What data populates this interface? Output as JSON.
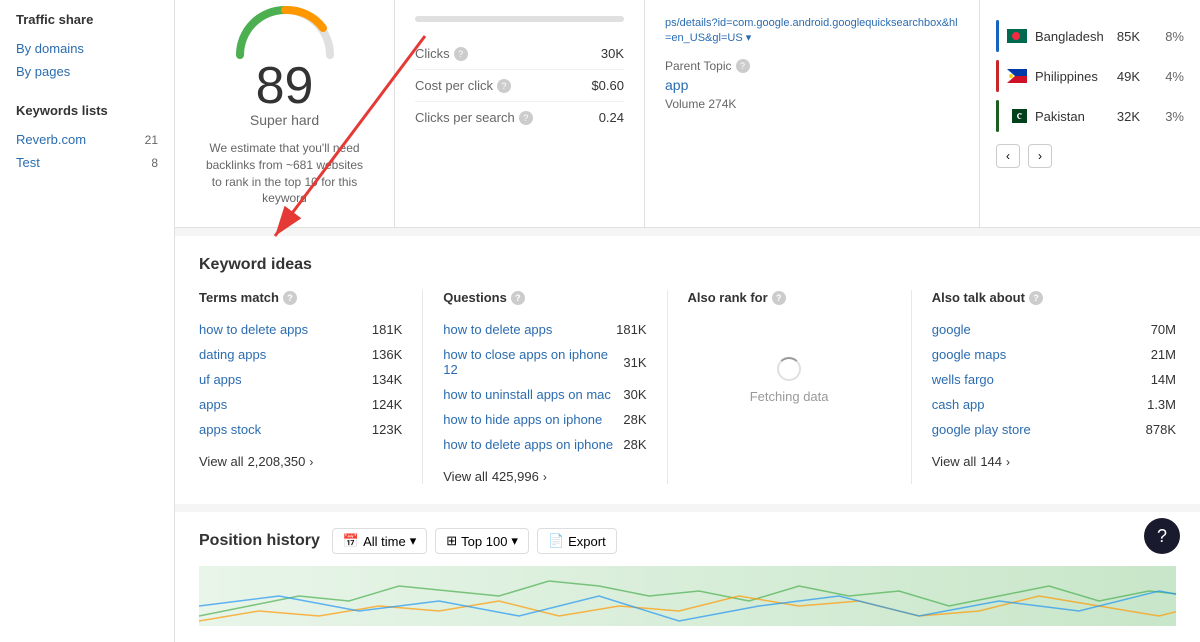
{
  "sidebar": {
    "traffic_share": {
      "title": "Traffic share",
      "items": [
        {
          "label": "By domains",
          "href": true
        },
        {
          "label": "By pages",
          "href": true
        }
      ]
    },
    "keywords_lists": {
      "title": "Keywords lists",
      "items": [
        {
          "label": "Reverb.com",
          "count": "21"
        },
        {
          "label": "Test",
          "count": "8"
        }
      ]
    }
  },
  "difficulty": {
    "score": "89",
    "label": "Super hard",
    "description": "We estimate that you'll need backlinks from ~681 websites to rank in the top 10 for this keyword"
  },
  "metrics": {
    "clicks_label": "Clicks",
    "clicks_value": "30K",
    "cpc_label": "Cost per click",
    "cpc_value": "$0.60",
    "cps_label": "Clicks per search",
    "cps_value": "0.24",
    "bar_green": 70,
    "bar_orange": 20
  },
  "url_panel": {
    "url": "ps/details?id=com.google.android.googlequicksearchbox&hl=en_US&gl=US",
    "dropdown_arrow": "▾",
    "parent_topic_label": "Parent Topic",
    "parent_topic_value": "app",
    "volume_label": "Volume 274K"
  },
  "countries": {
    "rows": [
      {
        "name": "Bangladesh",
        "volume": "85K",
        "pct": "8%",
        "color": "#1565c0"
      },
      {
        "name": "Philippines",
        "volume": "49K",
        "pct": "4%",
        "color": "#c62828"
      },
      {
        "name": "Pakistan",
        "volume": "32K",
        "pct": "3%",
        "color": "#1b5e20"
      }
    ],
    "prev_label": "‹",
    "next_label": "›"
  },
  "keyword_ideas": {
    "section_title": "Keyword ideas",
    "terms_match": {
      "header": "Terms match",
      "items": [
        {
          "keyword": "how to delete apps",
          "volume": "181K"
        },
        {
          "keyword": "dating apps",
          "volume": "136K"
        },
        {
          "keyword": "uf apps",
          "volume": "134K"
        },
        {
          "keyword": "apps",
          "volume": "124K"
        },
        {
          "keyword": "apps stock",
          "volume": "123K"
        }
      ],
      "view_all_prefix": "View all",
      "view_all_count": "2,208,350"
    },
    "questions": {
      "header": "Questions",
      "items": [
        {
          "keyword": "how to delete apps",
          "volume": "181K"
        },
        {
          "keyword": "how to close apps on iphone 12",
          "volume": "31K"
        },
        {
          "keyword": "how to uninstall apps on mac",
          "volume": "30K"
        },
        {
          "keyword": "how to hide apps on iphone",
          "volume": "28K"
        },
        {
          "keyword": "how to delete apps on iphone",
          "volume": "28K"
        }
      ],
      "view_all_prefix": "View all",
      "view_all_count": "425,996"
    },
    "also_rank_for": {
      "header": "Also rank for",
      "fetching": "Fetching data"
    },
    "also_talk_about": {
      "header": "Also talk about",
      "items": [
        {
          "keyword": "google",
          "volume": "70M"
        },
        {
          "keyword": "google maps",
          "volume": "21M"
        },
        {
          "keyword": "wells fargo",
          "volume": "14M"
        },
        {
          "keyword": "cash app",
          "volume": "1.3M"
        },
        {
          "keyword": "google play store",
          "volume": "878K"
        }
      ],
      "view_all_prefix": "View all",
      "view_all_count": "144"
    }
  },
  "position_history": {
    "title": "Position history",
    "controls": [
      {
        "icon": "📅",
        "label": "All time",
        "has_arrow": true
      },
      {
        "icon": "⊞",
        "label": "Top 100",
        "has_arrow": true
      },
      {
        "icon": "📄",
        "label": "Export",
        "has_arrow": false
      }
    ]
  },
  "help_button": {
    "label": "?"
  }
}
